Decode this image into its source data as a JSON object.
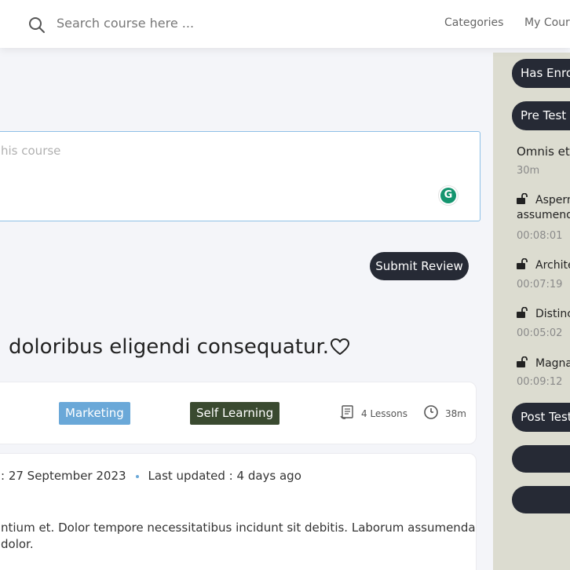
{
  "header": {
    "search_placeholder": "Search course here ...",
    "nav": [
      "Categories",
      "My Cours"
    ]
  },
  "review": {
    "placeholder": "his course",
    "grammarly_letter": "G",
    "submit_label": "Submit Review"
  },
  "course": {
    "title": ": doloribus eligendi consequatur.",
    "category_tag": "Marketing",
    "type_tag": "Self Learning",
    "lessons": "4 Lessons",
    "duration": "38m",
    "created": ": 27 September 2023",
    "last_updated": "Last updated : 4 days ago",
    "description_line1": "ntium et. Dolor tempore necessitatibus incidunt sit debitis. Laborum assumenda",
    "description_line2": "dolor."
  },
  "sidebar": {
    "enrolled_pill": "Has Enro",
    "pre_test_pill": "Pre Test",
    "section_title": "Omnis et r",
    "section_duration": "30m",
    "lessons": [
      {
        "title": "Aspern",
        "title2": "assumenda",
        "time": "00:08:01"
      },
      {
        "title": "Archite",
        "title2": "",
        "time": "00:07:19"
      },
      {
        "title": "Distinc",
        "title2": "",
        "time": "00:05:02"
      },
      {
        "title": "Magna",
        "title2": "",
        "time": "00:09:12"
      }
    ],
    "post_test_pill": "Post Test"
  },
  "colors": {
    "dark": "#262a35",
    "accent_blue": "#6aa8d8",
    "self_learning_green": "#3a4a30",
    "sidebar_bg": "#dcdcd0"
  }
}
